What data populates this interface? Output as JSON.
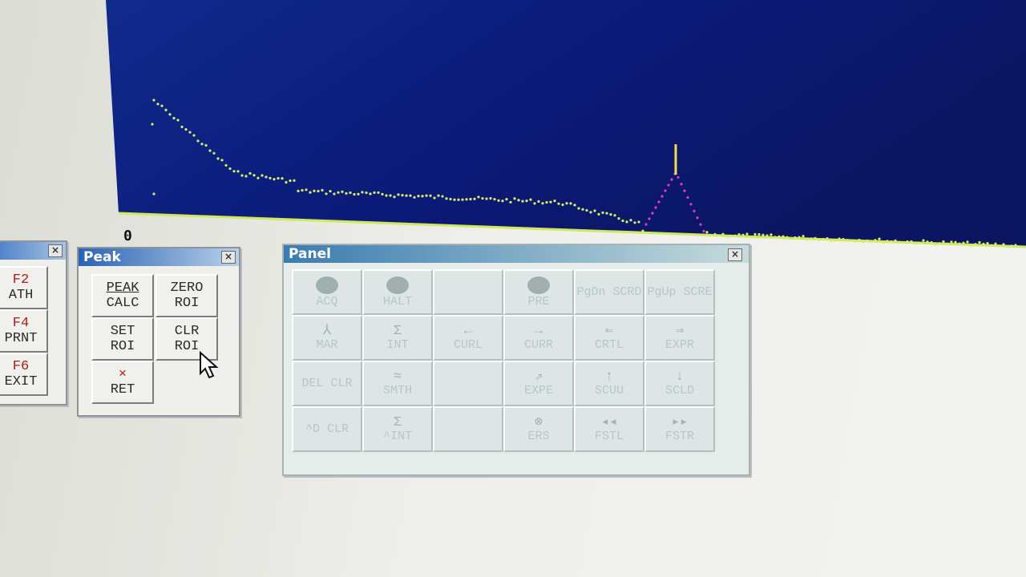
{
  "zero_marker": "0",
  "left_panel": {
    "buttons": [
      {
        "key": "F2",
        "label": "ATH"
      },
      {
        "key": "F4",
        "label": "PRNT"
      },
      {
        "key": "F6",
        "label": "EXIT"
      }
    ]
  },
  "peak": {
    "title": "Peak",
    "buttons": [
      {
        "line1": "PEAK",
        "line2": "CALC"
      },
      {
        "line1": "ZERO",
        "line2": "ROI"
      },
      {
        "line1": "SET",
        "line2": "ROI"
      },
      {
        "line1": "CLR",
        "line2": "ROI"
      },
      {
        "line1": "×",
        "line2": "RET"
      }
    ]
  },
  "panel": {
    "title": "Panel",
    "buttons": [
      {
        "icon": "●",
        "label": "ACQ"
      },
      {
        "icon": "●",
        "label": "HALT"
      },
      {
        "icon": "",
        "label": ""
      },
      {
        "icon": "●",
        "label": "PRE"
      },
      {
        "icon": "",
        "label": "PgDn SCRD"
      },
      {
        "icon": "",
        "label": "PgUp SCRE"
      },
      {
        "icon": "⅄",
        "label": "MAR"
      },
      {
        "icon": "Σ",
        "label": "INT"
      },
      {
        "icon": "←",
        "label": "CURL"
      },
      {
        "icon": "→",
        "label": "CURR"
      },
      {
        "icon": "⇐",
        "label": "CRTL"
      },
      {
        "icon": "⇒",
        "label": "EXPR"
      },
      {
        "icon": "",
        "label": "DEL CLR"
      },
      {
        "icon": "≈",
        "label": "SMTH"
      },
      {
        "icon": "",
        "label": ""
      },
      {
        "icon": "⇗",
        "label": "EXPE"
      },
      {
        "icon": "↑",
        "label": "SCUU"
      },
      {
        "icon": "↓",
        "label": "SCLD"
      },
      {
        "icon": "",
        "label": "^D CLR"
      },
      {
        "icon": "Σ",
        "label": "^INT"
      },
      {
        "icon": "",
        "label": ""
      },
      {
        "icon": "⊗",
        "label": "ERS"
      },
      {
        "icon": "◂◂",
        "label": "FSTL"
      },
      {
        "icon": "▸▸",
        "label": "FSTR"
      }
    ]
  },
  "colors": {
    "spectrum_bg": "#0b1670",
    "trace": "#d6ee6c",
    "roi_trace": "#e03cc8",
    "cursor": "#f0e04c",
    "titlebar": "#2a62b4"
  }
}
